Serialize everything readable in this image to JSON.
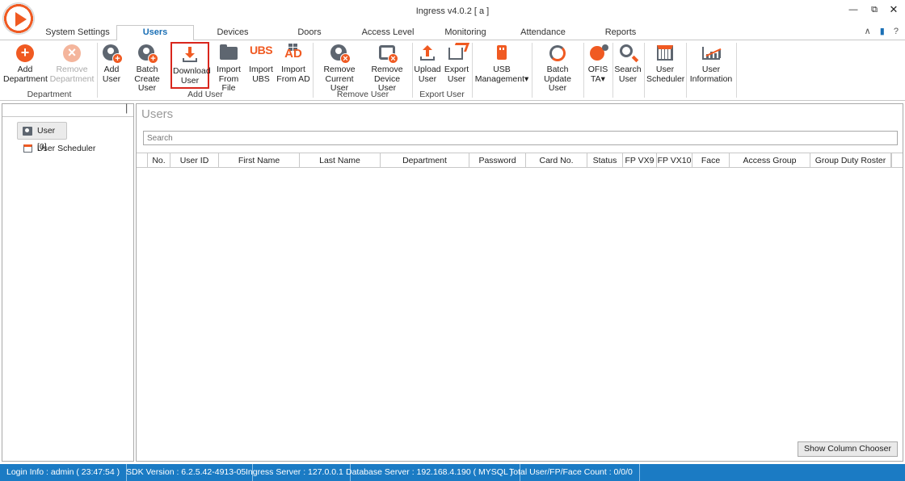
{
  "window": {
    "title": "Ingress v4.0.2 [ a ]",
    "min": "—",
    "max": "⧉",
    "close": "✕"
  },
  "tabs": [
    {
      "label": "System Settings"
    },
    {
      "label": "Users"
    },
    {
      "label": "Devices"
    },
    {
      "label": "Doors"
    },
    {
      "label": "Access Level"
    },
    {
      "label": "Monitoring"
    },
    {
      "label": "Attendance"
    },
    {
      "label": "Reports"
    }
  ],
  "tab_right": {
    "collapse": "∧",
    "help": "?"
  },
  "ribbon": {
    "groups": [
      "Department",
      "Add User",
      "Remove User",
      "Export User"
    ],
    "buttons": {
      "add_department": "Add\nDepartment",
      "remove_department": "Remove\nDepartment",
      "add_user": "Add\nUser",
      "batch_create_user": "Batch\nCreate User",
      "download_user": "Download\nUser",
      "import_from_file": "Import\nFrom File",
      "import_ubs": "Import\nUBS",
      "import_from_ad": "Import\nFrom AD",
      "remove_current_user": "Remove\nCurrent User",
      "remove_device_user": "Remove\nDevice User",
      "upload_user": "Upload\nUser",
      "export_user": "Export\nUser",
      "usb_management": "USB\nManagement▾",
      "batch_update_user": "Batch\nUpdate User",
      "ofis_ta": "OFIS\nTA▾",
      "search_user": "Search\nUser",
      "user_scheduler": "User\nScheduler",
      "user_information": "User\nInformation"
    },
    "icon_text": {
      "ubs": "UBS",
      "ad": "AD"
    }
  },
  "tree": {
    "user": "User [0]",
    "user_scheduler": "User Scheduler",
    "pin": "▕"
  },
  "main": {
    "heading": "Users",
    "search_placeholder": "Search",
    "columns": [
      "No.",
      "User ID",
      "First Name",
      "Last Name",
      "Department",
      "Password",
      "Card No.",
      "Status",
      "FP VX9",
      "FP VX10",
      "Face",
      "Access Group",
      "Group Duty Roster"
    ],
    "rows": [],
    "show_column_chooser": "Show Column Chooser"
  },
  "status": {
    "login": "Login Info : admin ( 23:47:54 )",
    "sdk": "SDK Version : 6.2.5.42-4913-05",
    "ingress_server": "Ingress Server : 127.0.0.1",
    "database_server": "Database Server : 192.168.4.190 ( MYSQL )",
    "total": "Total User/FP/Face Count : 0/0/0"
  },
  "colors": {
    "accent": "#f05a22",
    "status_bar": "#1b7bc4",
    "tab_active": "#1a6fb5",
    "highlight_border": "#d9261c",
    "icon_gray": "#5e6670"
  }
}
